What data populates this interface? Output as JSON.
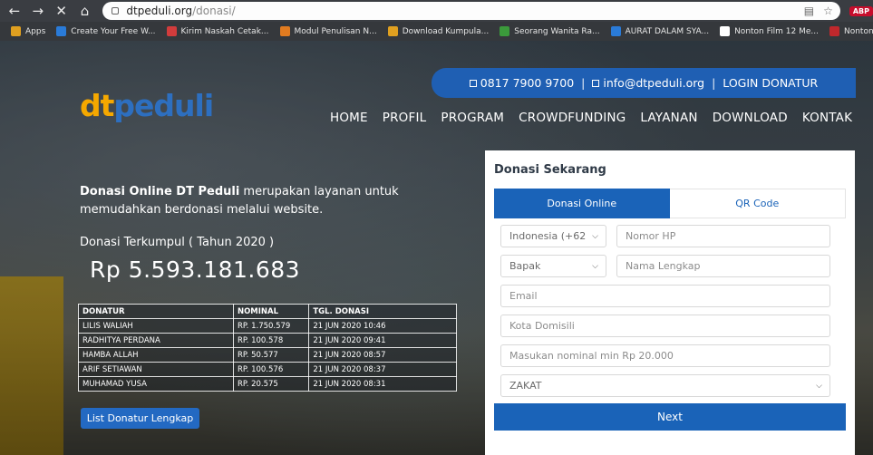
{
  "browser": {
    "url_host": "dtpeduli.org",
    "url_path": "/donasi/",
    "abp_label": "ABP"
  },
  "bookmarks": [
    {
      "label": "Apps",
      "color": "#e0a020"
    },
    {
      "label": "Create Your Free W...",
      "color": "#2a7bd8"
    },
    {
      "label": "Kirim Naskah Cetak...",
      "color": "#d23c3c"
    },
    {
      "label": "Modul Penulisan N...",
      "color": "#e07b20"
    },
    {
      "label": "Download Kumpula...",
      "color": "#e0a020"
    },
    {
      "label": "Seorang Wanita Ra...",
      "color": "#3b9a3b"
    },
    {
      "label": "AURAT DALAM SYA...",
      "color": "#2a7bd8"
    },
    {
      "label": "Nonton Film 12 Me...",
      "color": "#ffffff"
    },
    {
      "label": "Nonton Movie B",
      "color": "#c0282c"
    }
  ],
  "header": {
    "phone": "0817 7900 9700",
    "email": "info@dtpeduli.org",
    "login": "LOGIN DONATUR",
    "logo_dt": "dt",
    "logo_peduli": "peduli",
    "nav": [
      "HOME",
      "PROFIL",
      "PROGRAM",
      "CROWDFUNDING",
      "LAYANAN",
      "DOWNLOAD",
      "KONTAK"
    ]
  },
  "intro": {
    "bold": "Donasi Online DT Peduli",
    "rest": " merupakan layanan untuk memudahkan berdonasi melalui website."
  },
  "collected": {
    "label": "Donasi Terkumpul ( Tahun 2020 )",
    "amount": "Rp 5.593.181.683"
  },
  "donors": {
    "headers": [
      "DONATUR",
      "NOMINAL",
      "TGL. DONASI"
    ],
    "rows": [
      [
        "LILIS WALIAH",
        "RP. 1.750.579",
        "21 JUN 2020 10:46"
      ],
      [
        "RADHITYA PERDANA",
        "RP. 100.578",
        "21 JUN 2020 09:41"
      ],
      [
        "HAMBA ALLAH",
        "RP. 50.577",
        "21 JUN 2020 08:57"
      ],
      [
        "ARIF SETIAWAN",
        "RP. 100.576",
        "21 JUN 2020 08:37"
      ],
      [
        "MUHAMAD YUSA",
        "RP. 20.575",
        "21 JUN 2020 08:31"
      ]
    ],
    "button": "List Donatur Lengkap"
  },
  "form": {
    "title": "Donasi Sekarang",
    "tab_online": "Donasi Online",
    "tab_qr": "QR Code",
    "country_code": "Indonesia (+62",
    "phone_placeholder": "Nomor HP",
    "salutation": "Bapak",
    "name_placeholder": "Nama Lengkap",
    "email_placeholder": "Email",
    "city_placeholder": "Kota Domisili",
    "amount_placeholder": "Masukan nominal min Rp 20.000",
    "category": "ZAKAT",
    "next": "Next"
  },
  "colors": {
    "brand_blue": "#1a63b8",
    "logo_orange": "#f5a800"
  }
}
